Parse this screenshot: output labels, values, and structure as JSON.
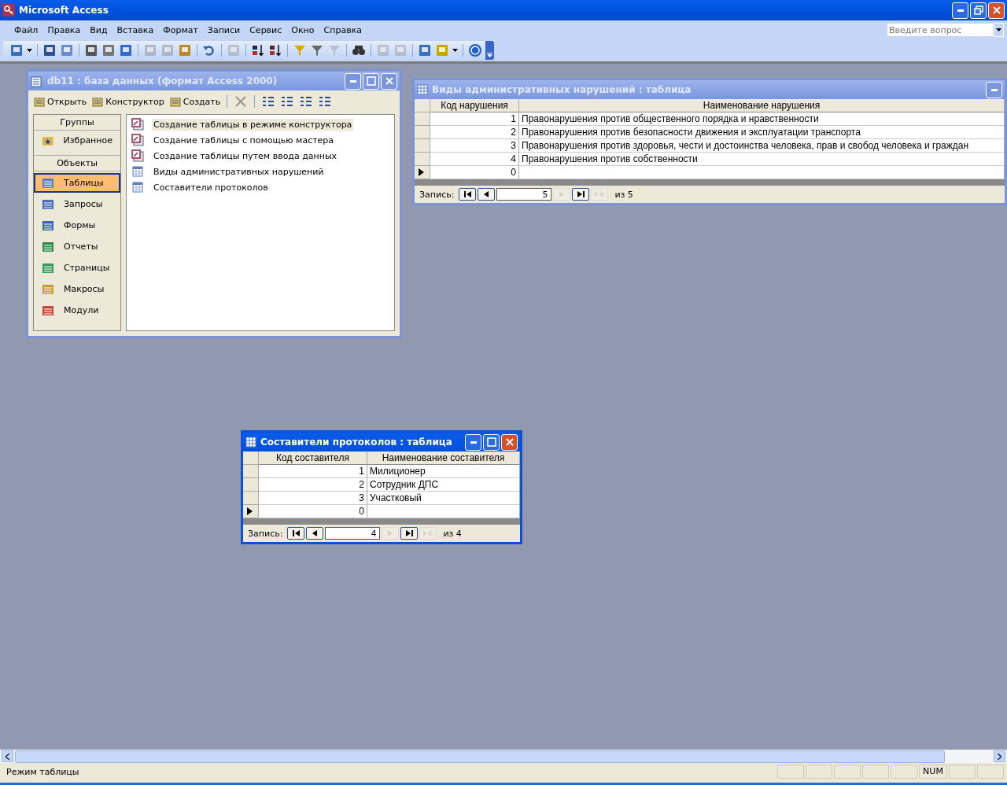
{
  "window": {
    "title": "Microsoft Access"
  },
  "menu": [
    "Файл",
    "Правка",
    "Вид",
    "Вставка",
    "Формат",
    "Записи",
    "Сервис",
    "Окно",
    "Справка"
  ],
  "toolbar": [
    {
      "kind": "view",
      "disabled": false
    },
    {
      "kind": "sep"
    },
    {
      "kind": "save",
      "disabled": false
    },
    {
      "kind": "search",
      "disabled": false
    },
    {
      "kind": "sep"
    },
    {
      "kind": "print",
      "disabled": false
    },
    {
      "kind": "preview",
      "disabled": false
    },
    {
      "kind": "spell",
      "disabled": false
    },
    {
      "kind": "sep"
    },
    {
      "kind": "cut",
      "disabled": true
    },
    {
      "kind": "copy",
      "disabled": true
    },
    {
      "kind": "paste",
      "disabled": false
    },
    {
      "kind": "sep"
    },
    {
      "kind": "undo",
      "disabled": false
    },
    {
      "kind": "sep"
    },
    {
      "kind": "link",
      "disabled": true
    },
    {
      "kind": "sep"
    },
    {
      "kind": "sort-asc",
      "disabled": false
    },
    {
      "kind": "sort-desc",
      "disabled": false
    },
    {
      "kind": "sep"
    },
    {
      "kind": "filter-sel",
      "disabled": false
    },
    {
      "kind": "filter-form",
      "disabled": false
    },
    {
      "kind": "filter",
      "disabled": true
    },
    {
      "kind": "sep"
    },
    {
      "kind": "find",
      "disabled": false
    },
    {
      "kind": "sep"
    },
    {
      "kind": "new-rec",
      "disabled": true
    },
    {
      "kind": "del-rec",
      "disabled": true
    },
    {
      "kind": "sep"
    },
    {
      "kind": "db-window",
      "disabled": false
    },
    {
      "kind": "new-object",
      "disabled": false
    },
    {
      "kind": "sep"
    },
    {
      "kind": "help",
      "disabled": false
    }
  ],
  "help_box": {
    "placeholder": "Введите вопрос"
  },
  "db_window": {
    "title": "db11 : база данных (формат Access 2000)",
    "actions": [
      {
        "kind": "open",
        "label": "Открыть",
        "disabled": false
      },
      {
        "kind": "design",
        "label": "Конструктор",
        "disabled": false
      },
      {
        "kind": "new",
        "label": "Создать",
        "disabled": false
      },
      {
        "kind": "delete",
        "disabled": true
      },
      {
        "kind": "large-icons",
        "disabled": false
      },
      {
        "kind": "small-icons",
        "disabled": false
      },
      {
        "kind": "list",
        "disabled": false
      },
      {
        "kind": "details",
        "disabled": false
      }
    ],
    "groups_heading": "Группы",
    "groups": [
      {
        "kind": "favorites",
        "label": "Избранное"
      }
    ],
    "objects_heading": "Объекты",
    "objects": [
      {
        "kind": "tables",
        "label": "Таблицы",
        "selected": true
      },
      {
        "kind": "queries",
        "label": "Запросы",
        "selected": false
      },
      {
        "kind": "forms",
        "label": "Формы",
        "selected": false
      },
      {
        "kind": "reports",
        "label": "Отчеты",
        "selected": false
      },
      {
        "kind": "pages",
        "label": "Страницы",
        "selected": false
      },
      {
        "kind": "macros",
        "label": "Макросы",
        "selected": false
      },
      {
        "kind": "modules",
        "label": "Модули",
        "selected": false
      }
    ],
    "items": [
      {
        "kind": "shortcut",
        "label": "Создание таблицы в режиме конструктора",
        "selected": true
      },
      {
        "kind": "shortcut",
        "label": "Создание таблицы с помощью мастера",
        "selected": false
      },
      {
        "kind": "shortcut",
        "label": "Создание таблицы путем ввода данных",
        "selected": false
      },
      {
        "kind": "table",
        "label": "Виды административных нарушений",
        "selected": false
      },
      {
        "kind": "table",
        "label": "Составители протоколов",
        "selected": false
      }
    ]
  },
  "tables": [
    {
      "title": "Виды административных нарушений : таблица",
      "active": false,
      "columns": [
        "Код нарушения",
        "Наименование нарушения"
      ],
      "rows": [
        {
          "cells": [
            "1",
            "Правонарушения против общественного порядка и нравственности"
          ],
          "current": false
        },
        {
          "cells": [
            "2",
            "Правонарушения против безопасности движения и эксплуатации транспорта"
          ],
          "current": false
        },
        {
          "cells": [
            "3",
            "Правонарушения против здоровья, чести и достоинства человека, прав и свобод человека и граждан"
          ],
          "current": false
        },
        {
          "cells": [
            "4",
            "Правонарушения против собственности"
          ],
          "current": false
        },
        {
          "cells": [
            "0",
            ""
          ],
          "current": true
        }
      ],
      "nav": {
        "label": "Запись:",
        "record": "5",
        "total": "из 5"
      }
    },
    {
      "title": "Составители протоколов : таблица",
      "active": true,
      "columns": [
        "Код составителя",
        "Наименование составителя"
      ],
      "rows": [
        {
          "cells": [
            "1",
            "Милиционер"
          ],
          "current": false
        },
        {
          "cells": [
            "2",
            "Сотрудник ДПС"
          ],
          "current": false
        },
        {
          "cells": [
            "3",
            "Участковый"
          ],
          "current": false
        },
        {
          "cells": [
            "0",
            ""
          ],
          "current": true
        }
      ],
      "nav": {
        "label": "Запись:",
        "record": "4",
        "total": "из 4"
      }
    }
  ],
  "status_bar": {
    "text": "Режим таблицы",
    "indicators": [
      "NUM"
    ]
  }
}
